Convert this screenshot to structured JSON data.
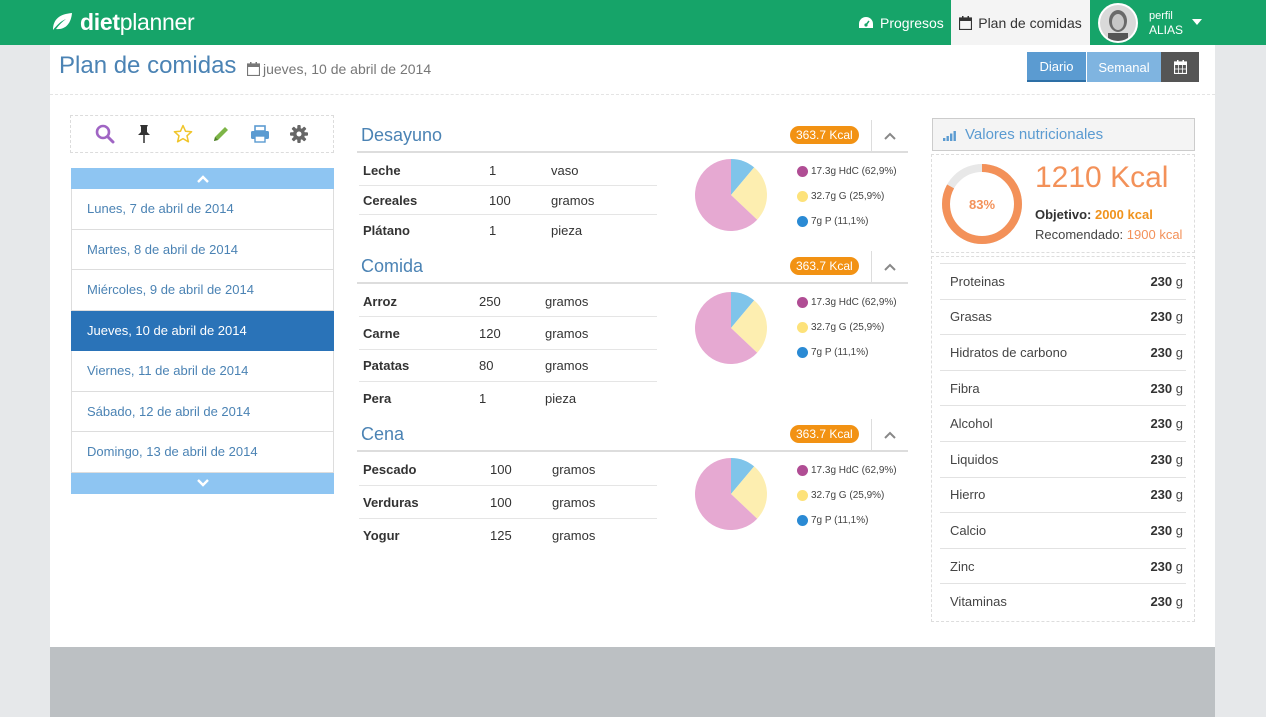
{
  "app": {
    "logo_bold": "diet",
    "logo_rest": "planner"
  },
  "nav": {
    "progresos": "Progresos",
    "plan": "Plan de comidas",
    "profile_small": "perfil",
    "profile_alias": "ALIAS"
  },
  "header": {
    "title": "Plan de comidas",
    "date": "jueves, 10 de abril de 2014",
    "view_daily": "Diario",
    "view_weekly": "Semanal"
  },
  "toolbar": {
    "icons": [
      "search-icon",
      "pin-icon",
      "star-icon",
      "pencil-icon",
      "print-icon",
      "gear-icon"
    ]
  },
  "days": [
    "Lunes, 7 de abril de 2014",
    "Martes, 8 de abril de 2014",
    "Miércoles, 9 de abril de 2014",
    "Jueves, 10 de abril de 2014",
    "Viernes, 11 de abril de 2014",
    "Sábado, 12 de abril de 2014",
    "Domingo, 13 de abril de 2014"
  ],
  "active_day_index": 3,
  "meals": [
    {
      "title": "Desayuno",
      "kcal": "363.7 Kcal",
      "foods": [
        {
          "name": "Leche",
          "qty": "1",
          "unit": "vaso"
        },
        {
          "name": "Cereales",
          "qty": "100",
          "unit": "gramos"
        },
        {
          "name": "Plátano",
          "qty": "1",
          "unit": "pieza"
        }
      ],
      "legend": [
        "17.3g HdC (62,9%)",
        "32.7g G (25,9%)",
        "7g P (11,1%)"
      ]
    },
    {
      "title": "Comida",
      "kcal": "363.7 Kcal",
      "foods": [
        {
          "name": "Arroz",
          "qty": "250",
          "unit": "gramos"
        },
        {
          "name": "Carne",
          "qty": "120",
          "unit": "gramos"
        },
        {
          "name": "Patatas",
          "qty": "80",
          "unit": "gramos"
        },
        {
          "name": "Pera",
          "qty": "1",
          "unit": "pieza"
        }
      ],
      "legend": [
        "17.3g HdC (62,9%)",
        "32.7g G (25,9%)",
        "7g P (11,1%)"
      ]
    },
    {
      "title": "Cena",
      "kcal": "363.7 Kcal",
      "foods": [
        {
          "name": "Pescado",
          "qty": "100",
          "unit": "gramos"
        },
        {
          "name": "Verduras",
          "qty": "100",
          "unit": "gramos"
        },
        {
          "name": "Yogur",
          "qty": "125",
          "unit": "gramos"
        }
      ],
      "legend": [
        "17.3g HdC (62,9%)",
        "32.7g G (25,9%)",
        "7g P (11,1%)"
      ]
    }
  ],
  "pie_shares": {
    "hdc": 62.9,
    "g": 25.9,
    "p": 11.1
  },
  "pie_colors": {
    "hdc": "#e6a9d2",
    "g": "#fdeeb0",
    "p": "#7fc4ea"
  },
  "legend_dot_colors": [
    "#b04d94",
    "#fde27a",
    "#2a8ad4"
  ],
  "nutrition": {
    "header": "Valores nutricionales",
    "percent_label": "83%",
    "percent": 83,
    "kcal": "1210 Kcal",
    "objective_label": "Objetivo:",
    "objective_value": "2000 kcal",
    "recommended_label": "Recomendado:",
    "recommended_value": "1900 kcal",
    "items": [
      {
        "label": "Proteinas",
        "value": "230",
        "unit": "g"
      },
      {
        "label": "Grasas",
        "value": "230",
        "unit": "g"
      },
      {
        "label": "Hidratos de carbono",
        "value": "230",
        "unit": "g"
      },
      {
        "label": "Fibra",
        "value": "230",
        "unit": "g"
      },
      {
        "label": "Alcohol",
        "value": "230",
        "unit": "g"
      },
      {
        "label": "Liquidos",
        "value": "230",
        "unit": "g"
      },
      {
        "label": "Hierro",
        "value": "230",
        "unit": "g"
      },
      {
        "label": "Calcio",
        "value": "230",
        "unit": "g"
      },
      {
        "label": "Zinc",
        "value": "230",
        "unit": "g"
      },
      {
        "label": "Vitaminas",
        "value": "230",
        "unit": "g"
      }
    ]
  },
  "colors": {
    "brand_green": "#16a469",
    "link_blue": "#4b83b4",
    "active_blue": "#2a73b8",
    "badge_orange": "#f29213",
    "ring_orange": "#f39159"
  }
}
